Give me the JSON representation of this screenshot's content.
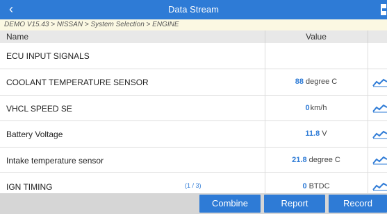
{
  "titlebar": {
    "back_glyph": "‹",
    "title": "Data Stream",
    "exit_icon": "exit-icon"
  },
  "breadcrumb": "DEMO V15.43 > NISSAN > System Selection > ENGINE",
  "table": {
    "headers": {
      "name": "Name",
      "value": "Value"
    },
    "rows": [
      {
        "name": "ECU INPUT SIGNALS",
        "value": "",
        "unit": ""
      },
      {
        "name": "COOLANT TEMPERATURE SENSOR",
        "value": "88",
        "unit": "degree C"
      },
      {
        "name": "VHCL SPEED SE",
        "value": "0",
        "unit": "km/h"
      },
      {
        "name": "Battery Voltage",
        "value": "11.8",
        "unit": "V"
      },
      {
        "name": "Intake temperature sensor",
        "value": "21.8",
        "unit": "degree C"
      },
      {
        "name": "IGN TIMING",
        "value": "0",
        "unit": "BTDC"
      }
    ],
    "pager": "(1 / 3)"
  },
  "footer": {
    "combine": "Combine",
    "report": "Report",
    "record": "Record"
  },
  "colors": {
    "accent": "#2e7bd6",
    "breadcrumb_bg": "#fbf8e2",
    "footer_bg": "#d6d6d6"
  }
}
